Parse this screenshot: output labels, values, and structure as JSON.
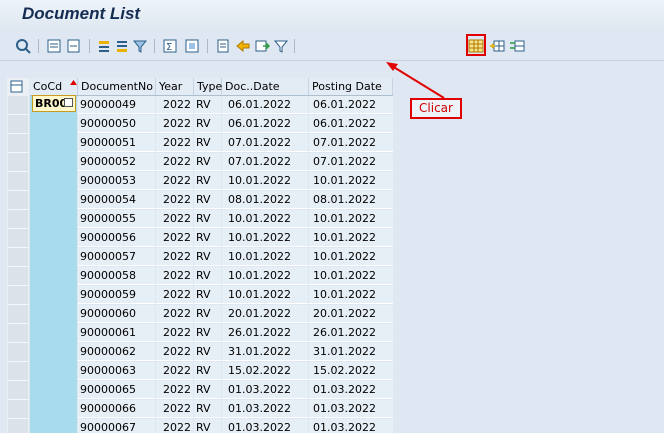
{
  "title": "Document List",
  "callout": "Clicar",
  "colors": {
    "highlight": "#e00000",
    "cocd_column": "#a8dcec",
    "cell": "#e6eef6"
  },
  "toolbar": {
    "icons": [
      "refresh-icon",
      "details-icon",
      "select-icon",
      "sort-ascending-icon",
      "sort-descending-icon",
      "filter-icon",
      "total-icon",
      "subtotal-icon",
      "print-icon",
      "export-icon",
      "layout-icon",
      "find-icon",
      "spreadsheet-icon",
      "insert-column-icon",
      "change-layout-icon"
    ]
  },
  "table": {
    "columns": [
      "CoCd",
      "DocumentNo",
      "Year",
      "Type",
      "Doc..Date",
      "Posting Date"
    ],
    "first_cocd": "BR00",
    "rows": [
      {
        "docno": "90000049",
        "year": "2022",
        "type": "RV",
        "docdate": "06.01.2022",
        "posting": "06.01.2022"
      },
      {
        "docno": "90000050",
        "year": "2022",
        "type": "RV",
        "docdate": "06.01.2022",
        "posting": "06.01.2022"
      },
      {
        "docno": "90000051",
        "year": "2022",
        "type": "RV",
        "docdate": "07.01.2022",
        "posting": "07.01.2022"
      },
      {
        "docno": "90000052",
        "year": "2022",
        "type": "RV",
        "docdate": "07.01.2022",
        "posting": "07.01.2022"
      },
      {
        "docno": "90000053",
        "year": "2022",
        "type": "RV",
        "docdate": "10.01.2022",
        "posting": "10.01.2022"
      },
      {
        "docno": "90000054",
        "year": "2022",
        "type": "RV",
        "docdate": "08.01.2022",
        "posting": "08.01.2022"
      },
      {
        "docno": "90000055",
        "year": "2022",
        "type": "RV",
        "docdate": "10.01.2022",
        "posting": "10.01.2022"
      },
      {
        "docno": "90000056",
        "year": "2022",
        "type": "RV",
        "docdate": "10.01.2022",
        "posting": "10.01.2022"
      },
      {
        "docno": "90000057",
        "year": "2022",
        "type": "RV",
        "docdate": "10.01.2022",
        "posting": "10.01.2022"
      },
      {
        "docno": "90000058",
        "year": "2022",
        "type": "RV",
        "docdate": "10.01.2022",
        "posting": "10.01.2022"
      },
      {
        "docno": "90000059",
        "year": "2022",
        "type": "RV",
        "docdate": "10.01.2022",
        "posting": "10.01.2022"
      },
      {
        "docno": "90000060",
        "year": "2022",
        "type": "RV",
        "docdate": "20.01.2022",
        "posting": "20.01.2022"
      },
      {
        "docno": "90000061",
        "year": "2022",
        "type": "RV",
        "docdate": "26.01.2022",
        "posting": "26.01.2022"
      },
      {
        "docno": "90000062",
        "year": "2022",
        "type": "RV",
        "docdate": "31.01.2022",
        "posting": "31.01.2022"
      },
      {
        "docno": "90000063",
        "year": "2022",
        "type": "RV",
        "docdate": "15.02.2022",
        "posting": "15.02.2022"
      },
      {
        "docno": "90000065",
        "year": "2022",
        "type": "RV",
        "docdate": "01.03.2022",
        "posting": "01.03.2022"
      },
      {
        "docno": "90000066",
        "year": "2022",
        "type": "RV",
        "docdate": "01.03.2022",
        "posting": "01.03.2022"
      },
      {
        "docno": "90000067",
        "year": "2022",
        "type": "RV",
        "docdate": "01.03.2022",
        "posting": "01.03.2022"
      }
    ]
  }
}
